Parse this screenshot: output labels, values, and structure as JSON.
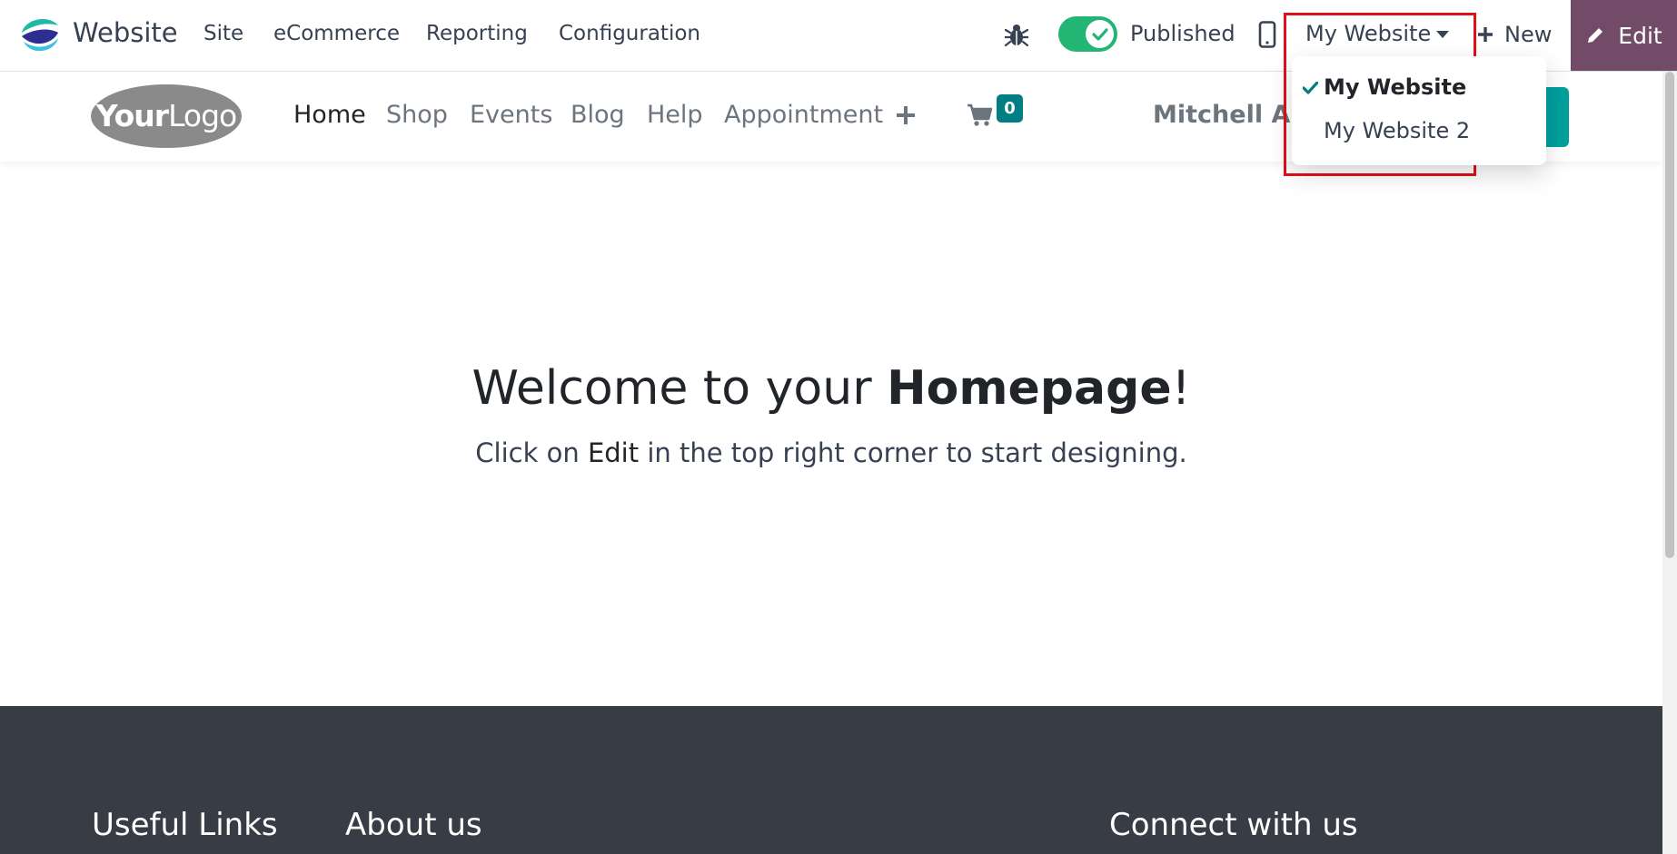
{
  "topbar": {
    "app_name": "Website",
    "menu": [
      "Site",
      "eCommerce",
      "Reporting",
      "Configuration"
    ],
    "published_label": "Published",
    "current_website": "My Website",
    "new_label": "New",
    "edit_label": "Edit"
  },
  "website_dropdown": {
    "items": [
      {
        "label": "My Website",
        "selected": true
      },
      {
        "label": "My Website 2",
        "selected": false
      }
    ]
  },
  "site_header": {
    "logo_text": "YourLogo",
    "nav": [
      "Home",
      "Shop",
      "Events",
      "Blog",
      "Help",
      "Appointment"
    ],
    "cart_count": "0",
    "user_name": "Mitchell Admin"
  },
  "hero": {
    "title_prefix": "Welcome to your ",
    "title_bold": "Homepage",
    "title_suffix": "!",
    "sub_prefix": "Click on ",
    "sub_bold": "Edit",
    "sub_suffix": " in the top right corner to start designing."
  },
  "footer": {
    "headings": [
      "Useful Links",
      "About us",
      "Connect with us"
    ]
  },
  "colors": {
    "brand_purple": "#714b67",
    "published_green": "#22b573",
    "teal": "#00a09d",
    "highlight_red": "#e0101a",
    "footer_bg": "#383c44"
  }
}
